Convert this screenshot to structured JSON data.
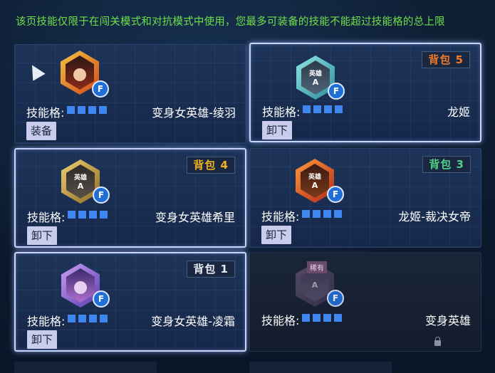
{
  "notice": "该页技能仅限于在闯关模式和对抗模式中使用，您最多可装备的技能不能超过技能格的总上限",
  "slot_label": "技能格:",
  "cards": [
    {
      "name": "变身女英雄-绫羽",
      "button": "装备",
      "bag": "",
      "emblem_text": "",
      "slots": 4
    },
    {
      "name": "龙姬",
      "button": "卸下",
      "bag": "背包 5",
      "bag_color": "#f07a2a",
      "emblem_text": "英雄",
      "slots": 4
    },
    {
      "name": "变身女英雄希里",
      "button": "卸下",
      "bag": "背包 4",
      "bag_color": "#f0b020",
      "emblem_text": "英雄",
      "slots": 4
    },
    {
      "name": "龙姬-裁决女帝",
      "button": "卸下",
      "bag": "背包 3",
      "bag_color": "#4ed08a",
      "emblem_text": "英雄",
      "slots": 4
    },
    {
      "name": "变身女英雄-凌霜",
      "button": "卸下",
      "bag": "背包 1",
      "bag_color": "#e6eaf2",
      "emblem_text": "",
      "slots": 4
    },
    {
      "name": "变身英雄",
      "button": "",
      "bag": "",
      "emblem_text": "稀有",
      "slots": 4
    }
  ],
  "badge_letter": "F",
  "rank_letter": "A"
}
